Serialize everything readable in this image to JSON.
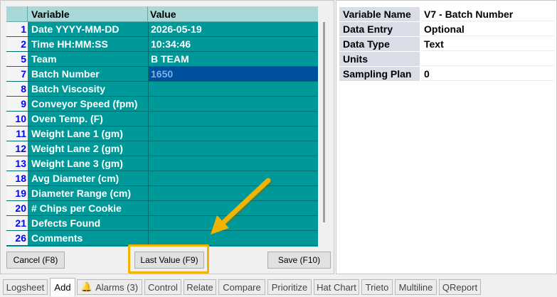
{
  "grid": {
    "header_variable": "Variable",
    "header_value": "Value",
    "rows": [
      {
        "num": "1",
        "name": "Date  YYYY-MM-DD",
        "value": "2026-05-19"
      },
      {
        "num": "2",
        "name": "Time  HH:MM:SS",
        "value": "10:34:46"
      },
      {
        "num": "5",
        "name": "Team",
        "value": "B TEAM"
      },
      {
        "num": "7",
        "name": "Batch Number",
        "value": "1650",
        "selected": true
      },
      {
        "num": "8",
        "name": "Batch Viscosity",
        "value": ""
      },
      {
        "num": "9",
        "name": "Conveyor Speed (fpm)",
        "value": ""
      },
      {
        "num": "10",
        "name": "Oven Temp. (F)",
        "value": ""
      },
      {
        "num": "11",
        "name": "Weight Lane 1 (gm)",
        "value": ""
      },
      {
        "num": "12",
        "name": "Weight Lane 2 (gm)",
        "value": ""
      },
      {
        "num": "13",
        "name": "Weight Lane 3 (gm)",
        "value": ""
      },
      {
        "num": "18",
        "name": "Avg Diameter (cm)",
        "value": ""
      },
      {
        "num": "19",
        "name": "Diameter Range (cm)",
        "value": ""
      },
      {
        "num": "20",
        "name": "# Chips per Cookie",
        "value": ""
      },
      {
        "num": "21",
        "name": "Defects Found",
        "value": ""
      },
      {
        "num": "26",
        "name": "Comments",
        "value": ""
      }
    ]
  },
  "buttons": {
    "cancel": "Cancel (F8)",
    "last_value": "Last Value (F9)",
    "save": "Save (F10)"
  },
  "properties": [
    {
      "label": "Variable Name",
      "value": "V7 - Batch Number"
    },
    {
      "label": "Data Entry",
      "value": "Optional"
    },
    {
      "label": "Data Type",
      "value": "Text"
    },
    {
      "label": "Units",
      "value": ""
    },
    {
      "label": "Sampling Plan",
      "value": "0"
    }
  ],
  "tabs": [
    {
      "label": "Logsheet"
    },
    {
      "label": "Add",
      "active": true
    },
    {
      "label": "Alarms (3)",
      "icon": "bell-icon"
    },
    {
      "label": "Control"
    },
    {
      "label": "Relate"
    },
    {
      "label": "Compare"
    },
    {
      "label": "Prioritize"
    },
    {
      "label": "Hat Chart"
    },
    {
      "label": "Trieto"
    },
    {
      "label": "Multiline"
    },
    {
      "label": "QReport"
    }
  ],
  "colors": {
    "grid_background": "#009999",
    "header_background": "#a9d8d8",
    "selected_cell": "#0050a0",
    "row_number": "#0000ff",
    "highlight": "#f2b400"
  }
}
